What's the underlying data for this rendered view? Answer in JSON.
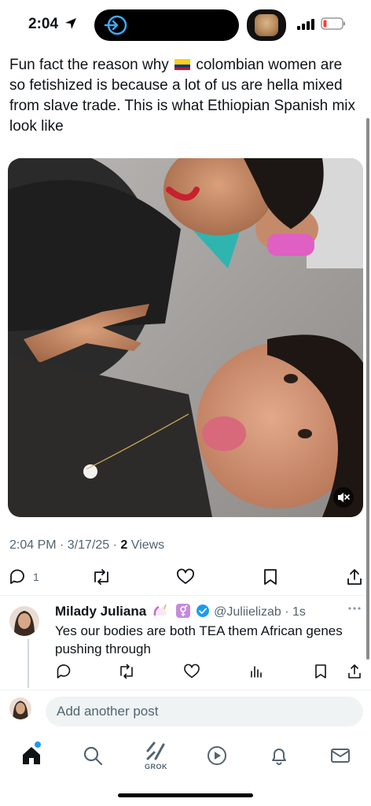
{
  "status_bar": {
    "time": "2:04"
  },
  "post": {
    "text_before_flag": "Fun fact the reason why ",
    "text_after_flag": " colombian women are so fetishized is because a lot of us are hella mixed from slave trade. This is what Ethiopian Spanish mix look like",
    "flag_icon": "colombia-flag-icon",
    "timestamp": "2:04 PM · 3/17/25 · ",
    "views_count": "2",
    "views_label": " Views",
    "reply_count": "1"
  },
  "reply": {
    "name": "Milady Juliana",
    "handle": "@Juliielizab",
    "time": " · 1s",
    "text": "Yes our bodies are both TEA them African genes pushing through"
  },
  "compose": {
    "placeholder": "Add another post"
  },
  "nav": {
    "grok_label": "GROK"
  },
  "colors": {
    "accent": "#1d9bf0",
    "text": "#0f1419",
    "secondary": "#536471"
  }
}
